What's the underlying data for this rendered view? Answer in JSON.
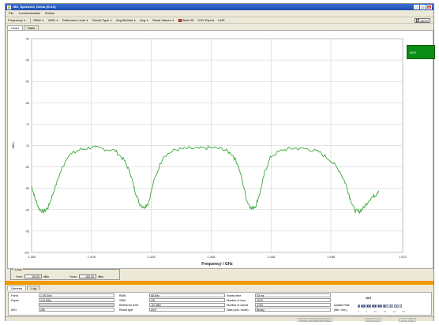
{
  "window": {
    "title": "MA_Spectrum_Demo (H.4.0)"
  },
  "titlebar_buttons": [
    "_",
    "□",
    "x"
  ],
  "menu": [
    "File",
    "Communication",
    "Extras"
  ],
  "toolbar": {
    "items": [
      "Frequency",
      "RBW",
      "VBW",
      "Reference Level",
      "Result Type",
      "Avg Method",
      "Avg",
      "Reset Values",
      "Start Off",
      "CSV Export",
      "LMS"
    ],
    "right_label": "AVCE"
  },
  "tabs_top": [
    "Chart",
    "Table"
  ],
  "avg_badge": "AVG",
  "yaxis_settings": {
    "title": "Y-Axis",
    "ymin_label": "Ymin:",
    "ymin_value": "-90,00",
    "ymin_unit": "dBm",
    "ymax_label": "Ymax:",
    "ymax_value": "-100,00",
    "ymax_unit": "dBm"
  },
  "tabs_bottom": [
    "General",
    "Log"
  ],
  "info": {
    "col1": [
      {
        "label": "Fcent",
        "value": "1.45 GHz"
      },
      {
        "label": "Fspan",
        "value": "124 MHz"
      },
      {
        "label": "",
        "value": ""
      },
      {
        "label": "AVG",
        "value": "256"
      }
    ],
    "col2": [
      {
        "label": "RBW",
        "value": "68 kHz"
      },
      {
        "label": "VBW",
        "value": "Off"
      },
      {
        "label": "Reference level",
        "value": "-30 dBm"
      },
      {
        "label": "Result type",
        "value": "AVG"
      }
    ],
    "col3": [
      {
        "label": "Sweep time",
        "value": "63 ms"
      },
      {
        "label": "Number of runs",
        "value": "2075"
      },
      {
        "label": "Number of values",
        "value": "4763"
      },
      {
        "label": "Data (univ. mode)",
        "value": "Binary"
      }
    ],
    "update_rate_label": "Update Rate",
    "update_rate_value": "15.5",
    "update_rate_unit": "[Wh / sec.]",
    "update_rate_fraction": 0.6,
    "bar_scale": [
      "0",
      "5",
      "10",
      "15",
      "20",
      "25"
    ]
  },
  "statusbar": {
    "device": "Device: MA-3000-SBFR-009",
    "fw": "FW: 31.0.0",
    "state": "Conn: | Rdy"
  },
  "chart_data": {
    "type": "line",
    "title": "",
    "xlabel": "Frequency / GHz",
    "ylabel": "dBm",
    "xlim": [
      1.388,
      1.512
    ],
    "ylim": [
      -100,
      -50
    ],
    "x_ticks": [
      "1.388",
      "1.408",
      "1.428",
      "1.448",
      "1.468",
      "1.488",
      "1.512"
    ],
    "y_ticks": [
      "-50",
      "-55",
      "-60",
      "-65",
      "-70",
      "-75",
      "-80",
      "-85",
      "-90",
      "-95",
      "-100"
    ],
    "grid": true,
    "series": [
      {
        "color": "#3aa83a",
        "x": [
          1.388,
          1.389,
          1.3905,
          1.392,
          1.3935,
          1.395,
          1.3975,
          1.4,
          1.404,
          1.408,
          1.412,
          1.416,
          1.419,
          1.421,
          1.4225,
          1.424,
          1.4255,
          1.427,
          1.429,
          1.432,
          1.436,
          1.44,
          1.444,
          1.448,
          1.452,
          1.455,
          1.457,
          1.4585,
          1.46,
          1.4615,
          1.463,
          1.4645,
          1.466,
          1.468,
          1.472,
          1.476,
          1.48,
          1.484,
          1.488,
          1.491,
          1.493,
          1.4945,
          1.496,
          1.4975,
          1.499,
          1.501,
          1.503,
          1.504
        ],
        "values": [
          -84.5,
          -87,
          -89.8,
          -90.5,
          -89.5,
          -86.5,
          -81.5,
          -77.5,
          -76.0,
          -75.4,
          -75.8,
          -76.2,
          -78.5,
          -81.5,
          -85.5,
          -88.5,
          -89.5,
          -88.5,
          -83.0,
          -77.5,
          -76.0,
          -75.7,
          -75.7,
          -75.5,
          -75.8,
          -77.0,
          -79.5,
          -83.5,
          -88.0,
          -89.8,
          -89.0,
          -85.5,
          -81.0,
          -77.5,
          -76.0,
          -75.6,
          -75.8,
          -76.5,
          -78.5,
          -81.0,
          -84.0,
          -87.5,
          -90.2,
          -90.5,
          -89.5,
          -87.5,
          -86.5,
          -85.5
        ]
      }
    ]
  }
}
